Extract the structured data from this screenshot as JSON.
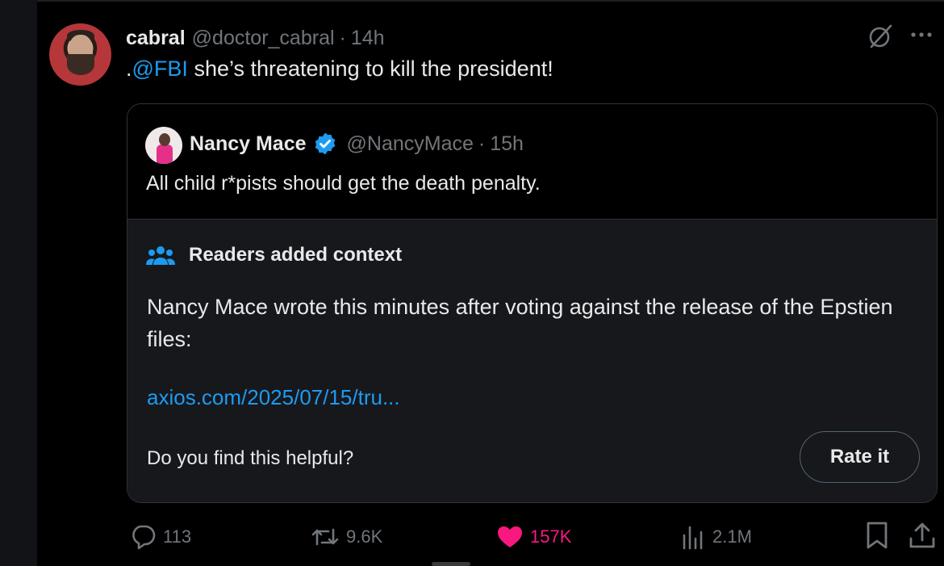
{
  "tweet": {
    "author_name": "cabral",
    "author_handle": "@doctor_cabral",
    "separator": "·",
    "time": "14h",
    "text_prefix": ".",
    "mention": "@FBI",
    "text_rest": " she’s threatening to kill the president!"
  },
  "quote": {
    "author_name": "Nancy Mace",
    "author_handle": "@NancyMace",
    "separator": "·",
    "time": "15h",
    "text": "All child r*pists should get the death penalty."
  },
  "context_note": {
    "title": "Readers added context",
    "body": "Nancy Mace wrote this minutes after voting against the release of the Epstien files:",
    "link": "axios.com/2025/07/15/tru...",
    "question": "Do you find this helpful?",
    "rate_label": "Rate it"
  },
  "actions": {
    "replies": "113",
    "reposts": "9.6K",
    "likes": "157K",
    "views": "2.1M"
  },
  "icons": {
    "grok": "grok-icon",
    "more": "more-icon",
    "verified": "verified-badge-icon",
    "context": "people-icon",
    "reply": "reply-icon",
    "repost": "repost-icon",
    "like": "heart-icon",
    "views": "views-icon",
    "bookmark": "bookmark-icon",
    "share": "share-icon"
  },
  "colors": {
    "background": "#000000",
    "link": "#1d9bf0",
    "like": "#f91880",
    "muted": "#71767b",
    "verified": "#1d9bf0"
  }
}
